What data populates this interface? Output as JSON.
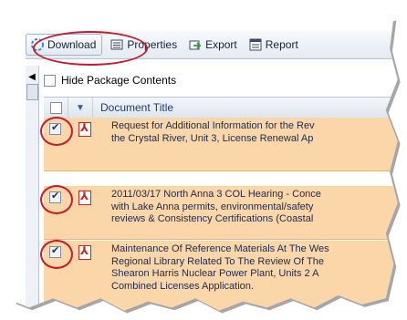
{
  "toolbar": {
    "download_label": "Download",
    "properties_label": "Properties",
    "export_label": "Export",
    "report_label": "Report"
  },
  "options": {
    "hide_package_contents_label": "Hide Package Contents",
    "hide_package_contents_checked": false
  },
  "table": {
    "column_title": "Document Title",
    "rows": [
      {
        "checked": true,
        "type_icon": "pdf-icon",
        "lines": [
          "Request for Additional Information for the Rev",
          "the Crystal River, Unit 3, License Renewal Ap"
        ]
      },
      {
        "checked": true,
        "type_icon": "pdf-icon",
        "lines": [
          "2011/03/17 North Anna 3 COL Hearing - Conce",
          "with Lake Anna permits, environmental/safety",
          "reviews & Consistency Certifications (Coastal"
        ]
      },
      {
        "checked": true,
        "type_icon": "pdf-icon",
        "lines": [
          "Maintenance Of Reference Materials At The Wes",
          "Regional Library Related To The Review Of The",
          "Shearon Harris Nuclear Power Plant, Units 2 A",
          "Combined Licenses Application."
        ]
      }
    ]
  },
  "colors": {
    "row_highlight": "#fbd6a8",
    "annotation_ring": "#c8192a",
    "link_text": "#1c2a55"
  }
}
